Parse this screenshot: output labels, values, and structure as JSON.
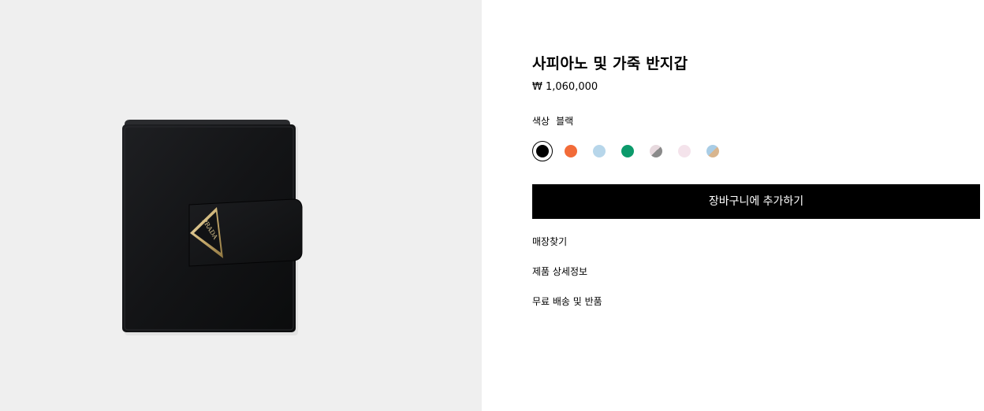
{
  "product": {
    "image_alt": "사피아노 및 가죽 반지갑",
    "logo_text": "PRADA",
    "title": "사피아노 및 가죽 반지갑",
    "price": "₩ 1,060,000",
    "color_label": "색상",
    "color_value": "블랙"
  },
  "swatches": [
    {
      "name": "black",
      "color": "#000000",
      "selected": true
    },
    {
      "name": "orange",
      "color": "#f26b38"
    },
    {
      "name": "light-blue",
      "color": "#b7d6ea"
    },
    {
      "name": "green",
      "color": "#0c9a6b"
    },
    {
      "name": "pink-grey",
      "color": "#e7d9de",
      "color2": "#8a8a8a"
    },
    {
      "name": "light-pink",
      "color": "#f4e3eb"
    },
    {
      "name": "blue-beige",
      "color": "#a9cde6",
      "color2": "#d8b58e"
    }
  ],
  "actions": {
    "add_to_cart": "장바구니에 추가하기"
  },
  "links": {
    "store_finder": "매장찾기",
    "product_details": "제품 상세정보",
    "shipping_returns": "무료 배송 및 반품"
  },
  "colors": {
    "image_background": "#efefef",
    "button": "#000000",
    "button_text": "#ffffff"
  }
}
